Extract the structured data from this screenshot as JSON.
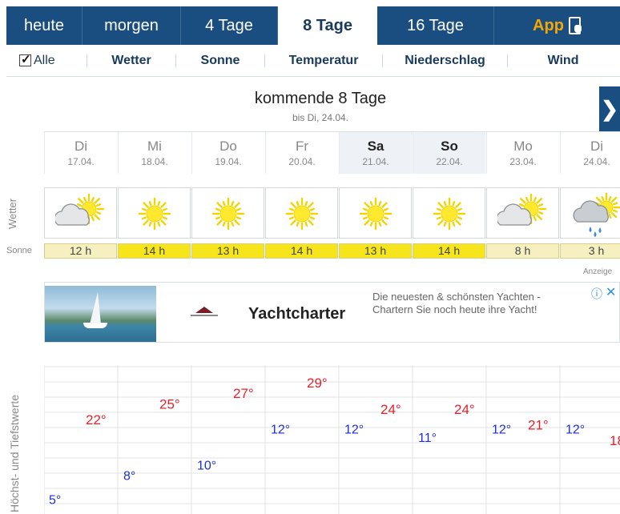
{
  "tabs": [
    {
      "label": "heute",
      "name": "tab-heute"
    },
    {
      "label": "morgen",
      "name": "tab-morgen"
    },
    {
      "label": "4 Tage",
      "name": "tab-4-tage"
    },
    {
      "label": "8 Tage",
      "name": "tab-8-tage"
    },
    {
      "label": "16 Tage",
      "name": "tab-16-tage"
    },
    {
      "label": "App",
      "name": "tab-app"
    }
  ],
  "subnav": {
    "all_label": "Alle",
    "all_checked": true,
    "items": [
      "Wetter",
      "Sonne",
      "Temperatur",
      "Niederschlag",
      "Wind"
    ]
  },
  "forecast": {
    "title": "kommende 8 Tage",
    "subtitle": "bis Di, 24.04.",
    "next_icon": "❯"
  },
  "days": [
    {
      "name": "Di",
      "date": "17.04.",
      "weekend": false,
      "icon": "cloud-sun-icon",
      "sun": "12 h",
      "high": 22,
      "low": 5
    },
    {
      "name": "Mi",
      "date": "18.04.",
      "weekend": false,
      "icon": "sun-icon",
      "sun": "14 h",
      "high": 25,
      "low": 8
    },
    {
      "name": "Do",
      "date": "19.04.",
      "weekend": false,
      "icon": "sun-icon",
      "sun": "13 h",
      "high": 27,
      "low": 10
    },
    {
      "name": "Fr",
      "date": "20.04.",
      "weekend": false,
      "icon": "sun-icon",
      "sun": "14 h",
      "high": 29,
      "low": 12
    },
    {
      "name": "Sa",
      "date": "21.04.",
      "weekend": true,
      "icon": "sun-icon",
      "sun": "13 h",
      "high": 24,
      "low": 12
    },
    {
      "name": "So",
      "date": "22.04.",
      "weekend": true,
      "icon": "sun-icon",
      "sun": "14 h",
      "high": 24,
      "low": 11
    },
    {
      "name": "Mo",
      "date": "23.04.",
      "weekend": false,
      "icon": "cloud-sun-icon",
      "sun": "8 h",
      "high": 21,
      "low": 12
    },
    {
      "name": "Di",
      "date": "24.04.",
      "weekend": false,
      "icon": "cloud-sun-rain-icon",
      "sun": "3 h",
      "high": 18,
      "low": 12
    }
  ],
  "labels": {
    "wetter": "Wetter",
    "sonne": "Sonne",
    "temps": "Höchst- und Tiefstwerte",
    "ad": "Anzeige"
  },
  "ad": {
    "title": "Yachtcharter",
    "text": "Die neuesten & schönsten Yachten - Chartern Sie noch heute ihre Yacht!",
    "info_icon": "ⓘ",
    "close_icon": "✕"
  },
  "colors": {
    "nav": "#1a4e80",
    "high_temp": "#e8202a",
    "low_temp": "#1f2fd6",
    "sun_high": "#f5e51a",
    "sun_low": "#f6f0c0",
    "app": "#f5a800"
  }
}
